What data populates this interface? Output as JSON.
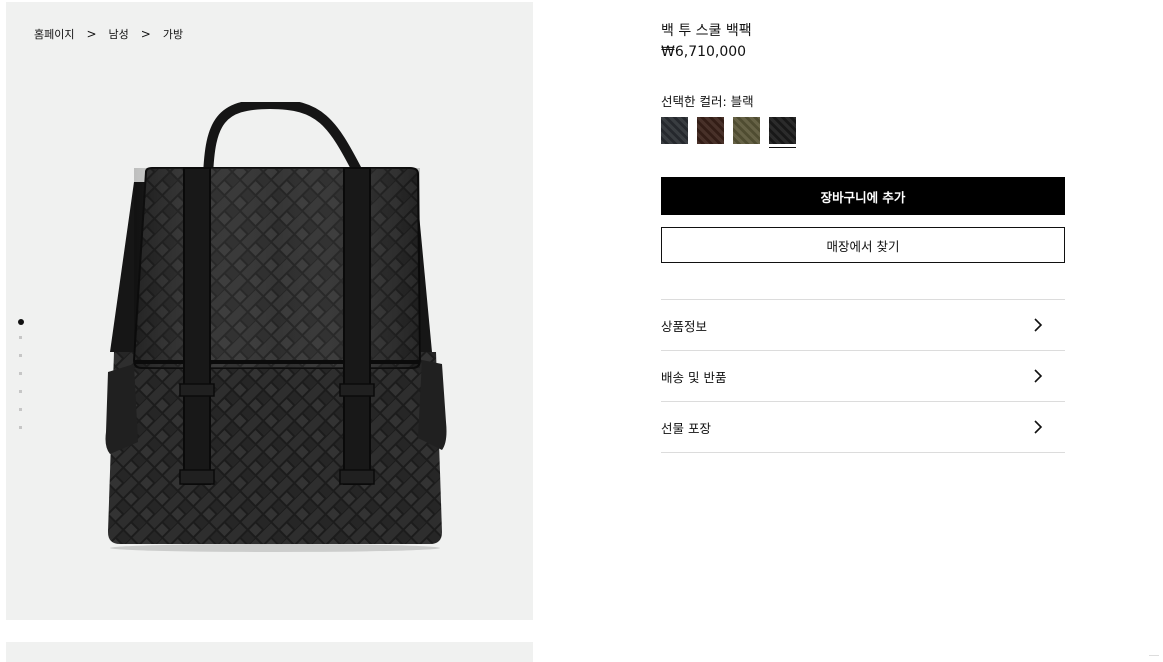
{
  "breadcrumb": {
    "home": "홈페이지",
    "men": "남성",
    "bags": "가방",
    "separator": ">"
  },
  "gallery": {
    "image_count": 7,
    "active_index": 0,
    "background": "#f0f1f0"
  },
  "product": {
    "title": "백 투 스쿨 백팩",
    "price": "₩6,710,000",
    "color_label": "선택한 컬러: 블랙",
    "swatches": [
      {
        "color": "#2a2e33",
        "selected": false
      },
      {
        "color": "#3a2119",
        "selected": false
      },
      {
        "color": "#5a5638",
        "selected": false
      },
      {
        "color": "#1b1b1b",
        "selected": true
      }
    ]
  },
  "actions": {
    "add_to_cart": "장바구니에 추가",
    "find_in_store": "매장에서 찾기"
  },
  "accordion": {
    "items": [
      {
        "label": "상품정보"
      },
      {
        "label": "배송 및 반품"
      },
      {
        "label": "선물 포장"
      }
    ]
  },
  "colors": {
    "button_primary": "#000000",
    "divider": "#dcdcdc"
  }
}
